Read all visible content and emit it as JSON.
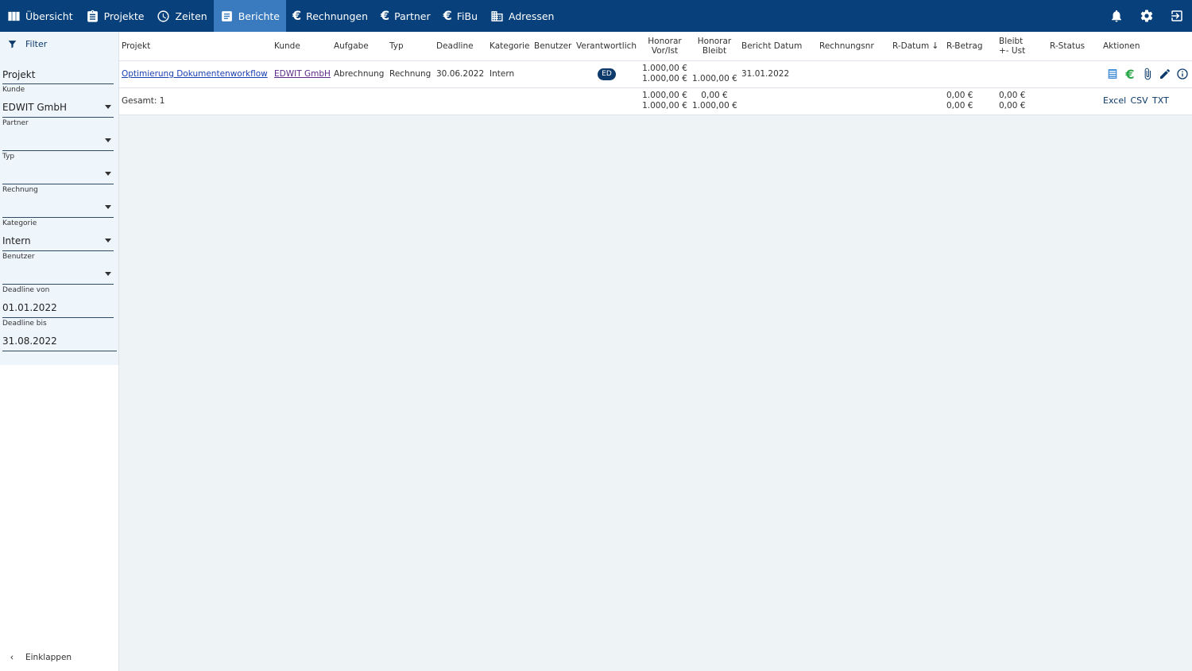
{
  "nav": {
    "items": [
      {
        "label": "Übersicht"
      },
      {
        "label": "Projekte"
      },
      {
        "label": "Zeiten"
      },
      {
        "label": "Berichte"
      },
      {
        "label": "Rechnungen"
      },
      {
        "label": "Partner"
      },
      {
        "label": "FiBu"
      },
      {
        "label": "Adressen"
      }
    ],
    "euro_glyph": "€",
    "right_icons": [
      "bell-icon",
      "gear-icon",
      "logout-icon"
    ],
    "active": "Berichte"
  },
  "sidebar": {
    "filter_title": "Filter",
    "projekt": {
      "value": "Projekt"
    },
    "kunde": {
      "label": "Kunde",
      "value": "EDWIT GmbH"
    },
    "partner": {
      "label": "Partner",
      "value": ""
    },
    "typ": {
      "label": "Typ",
      "value": ""
    },
    "rechnung": {
      "label": "Rechnung",
      "value": ""
    },
    "kategorie": {
      "label": "Kategorie",
      "value": "Intern"
    },
    "benutzer": {
      "label": "Benutzer",
      "value": ""
    },
    "deadline_von": {
      "label": "Deadline von",
      "value": "01.01.2022"
    },
    "deadline_bis": {
      "label": "Deadline bis",
      "value": "31.08.2022"
    },
    "collapse_label": "Einklappen"
  },
  "table": {
    "headers": {
      "projekt": "Projekt",
      "kunde": "Kunde",
      "aufgabe": "Aufgabe",
      "typ": "Typ",
      "deadline": "Deadline",
      "kategorie": "Kategorie",
      "benutzer": "Benutzer",
      "verantwortlich": "Verantwortlich",
      "honorar_vorist_1": "Honorar",
      "honorar_vorist_2": "Vor/Ist",
      "honorar_bleibt_1": "Honorar",
      "honorar_bleibt_2": "Bleibt",
      "bericht_datum": "Bericht Datum",
      "rechnungsnr": "Rechnungsnr",
      "r_datum": "R-Datum",
      "sort_arrow": "↓",
      "r_betrag": "R-Betrag",
      "bleibt_ust_1": "Bleibt",
      "bleibt_ust_2": "+- Ust",
      "r_status": "R-Status",
      "aktionen": "Aktionen"
    },
    "row": {
      "projekt": "Optimierung Dokumentenworkflow",
      "kunde": "EDWIT GmbH",
      "aufgabe": "Abrechnung",
      "typ": "Rechnung",
      "deadline": "30.06.2022",
      "kategorie": "Intern",
      "verantwortlich": "ED",
      "honorar_vor": "1.000,00 €",
      "honorar_ist": "1.000,00 €",
      "honorar_bleibt": "1.000,00 €",
      "bericht_datum": "31.01.2022"
    },
    "total": {
      "label": "Gesamt: 1",
      "honorar_vor": "1.000,00 €",
      "honorar_ist": "1.000,00 €",
      "bleibt_1": "0,00 €",
      "bleibt_2": "1.000,00 €",
      "r_betrag_1": "0,00 €",
      "r_betrag_2": "0,00 €",
      "bleibt_ust_1": "0,00 €",
      "bleibt_ust_2": "0,00 €",
      "export_excel": "Excel",
      "export_csv": "CSV",
      "export_txt": "TXT"
    }
  },
  "colors": {
    "nav_bg": "#07407a",
    "nav_active": "#3a7bbf",
    "euro_green": "#2aa84a"
  }
}
